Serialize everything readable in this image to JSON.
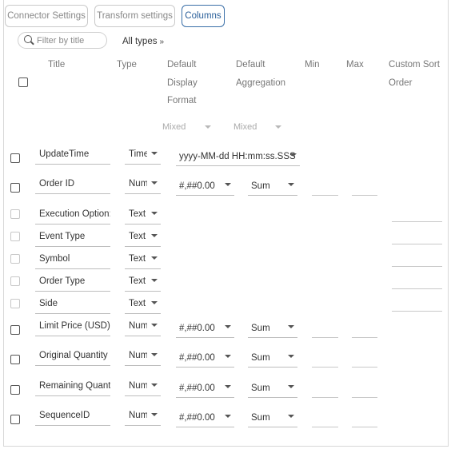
{
  "tabs": [
    {
      "label": "Connector Settings",
      "active": false
    },
    {
      "label": "Transform settings",
      "active": false
    },
    {
      "label": "Columns",
      "active": true
    }
  ],
  "filter": {
    "placeholder": "Filter by title",
    "types_label": "All types",
    "types_icon": "double-chevron-down-icon"
  },
  "header": {
    "title": "Title",
    "type": "Type",
    "display_format": [
      "Default",
      "Display",
      "Format"
    ],
    "aggregation": [
      "Default",
      "Aggregation"
    ],
    "min": "Min",
    "max": "Max",
    "custom_sort": [
      "Custom Sort",
      "Order"
    ]
  },
  "bulk": {
    "display_format": "Mixed",
    "aggregation": "Mixed"
  },
  "rows": [
    {
      "title": "UpdateTime",
      "type": "Time",
      "format": "yyyy-MM-dd HH:mm:ss.SSS",
      "aggregation": ""
    },
    {
      "title": "Order ID",
      "type": "Num",
      "format": "#,##0.00",
      "aggregation": "Sum"
    },
    {
      "title": "Execution Option:",
      "type": "Text",
      "format": "",
      "aggregation": ""
    },
    {
      "title": "Event Type",
      "type": "Text",
      "format": "",
      "aggregation": ""
    },
    {
      "title": "Symbol",
      "type": "Text",
      "format": "",
      "aggregation": ""
    },
    {
      "title": "Order Type",
      "type": "Text",
      "format": "",
      "aggregation": ""
    },
    {
      "title": "Side",
      "type": "Text",
      "format": "",
      "aggregation": ""
    },
    {
      "title": "Limit Price (USD)",
      "type": "Num",
      "format": "#,##0.00",
      "aggregation": "Sum"
    },
    {
      "title": "Original Quantity",
      "type": "Num",
      "format": "#,##0.00",
      "aggregation": "Sum"
    },
    {
      "title": "Remaining Quant",
      "type": "Num",
      "format": "#,##0.00",
      "aggregation": "Sum"
    },
    {
      "title": "SequenceID",
      "type": "Num",
      "format": "#,##0.00",
      "aggregation": "Sum"
    }
  ]
}
